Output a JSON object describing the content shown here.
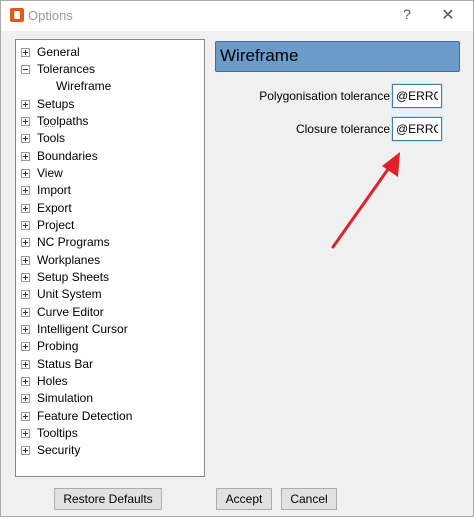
{
  "window": {
    "title": "Options",
    "help_glyph": "?",
    "close_glyph": "✕"
  },
  "tree": {
    "items": [
      {
        "label": "General",
        "expander": "plus"
      },
      {
        "label": "Tolerances",
        "expander": "minus"
      },
      {
        "label": "Wireframe",
        "expander": "none",
        "child": true
      },
      {
        "label": "Setups",
        "expander": "plus"
      },
      {
        "label": "Toolpaths",
        "expander": "plus"
      },
      {
        "label": "Tools",
        "expander": "plus"
      },
      {
        "label": "Boundaries",
        "expander": "plus"
      },
      {
        "label": "View",
        "expander": "plus"
      },
      {
        "label": "Import",
        "expander": "plus"
      },
      {
        "label": "Export",
        "expander": "plus"
      },
      {
        "label": "Project",
        "expander": "plus"
      },
      {
        "label": "NC Programs",
        "expander": "plus"
      },
      {
        "label": "Workplanes",
        "expander": "plus"
      },
      {
        "label": "Setup Sheets",
        "expander": "plus"
      },
      {
        "label": "Unit System",
        "expander": "plus"
      },
      {
        "label": "Curve Editor",
        "expander": "plus"
      },
      {
        "label": "Intelligent Cursor",
        "expander": "plus"
      },
      {
        "label": "Probing",
        "expander": "plus"
      },
      {
        "label": "Status Bar",
        "expander": "plus"
      },
      {
        "label": "Holes",
        "expander": "plus"
      },
      {
        "label": "Simulation",
        "expander": "plus"
      },
      {
        "label": "Feature Detection",
        "expander": "plus"
      },
      {
        "label": "Tooltips",
        "expander": "plus"
      },
      {
        "label": "Security",
        "expander": "plus"
      }
    ]
  },
  "panel": {
    "title": "Wireframe",
    "fields": [
      {
        "label": "Polygonisation tolerance",
        "value": "@ERROR"
      },
      {
        "label": "Closure tolerance",
        "value": "@ERROR"
      }
    ]
  },
  "annotation": {
    "arrow_color": "#e0202a"
  },
  "buttons": {
    "restore_defaults": "Restore Defaults",
    "accept": "Accept",
    "cancel": "Cancel"
  },
  "colors": {
    "header_bg": "#6b9bc9",
    "input_border": "#3c7fb1"
  }
}
